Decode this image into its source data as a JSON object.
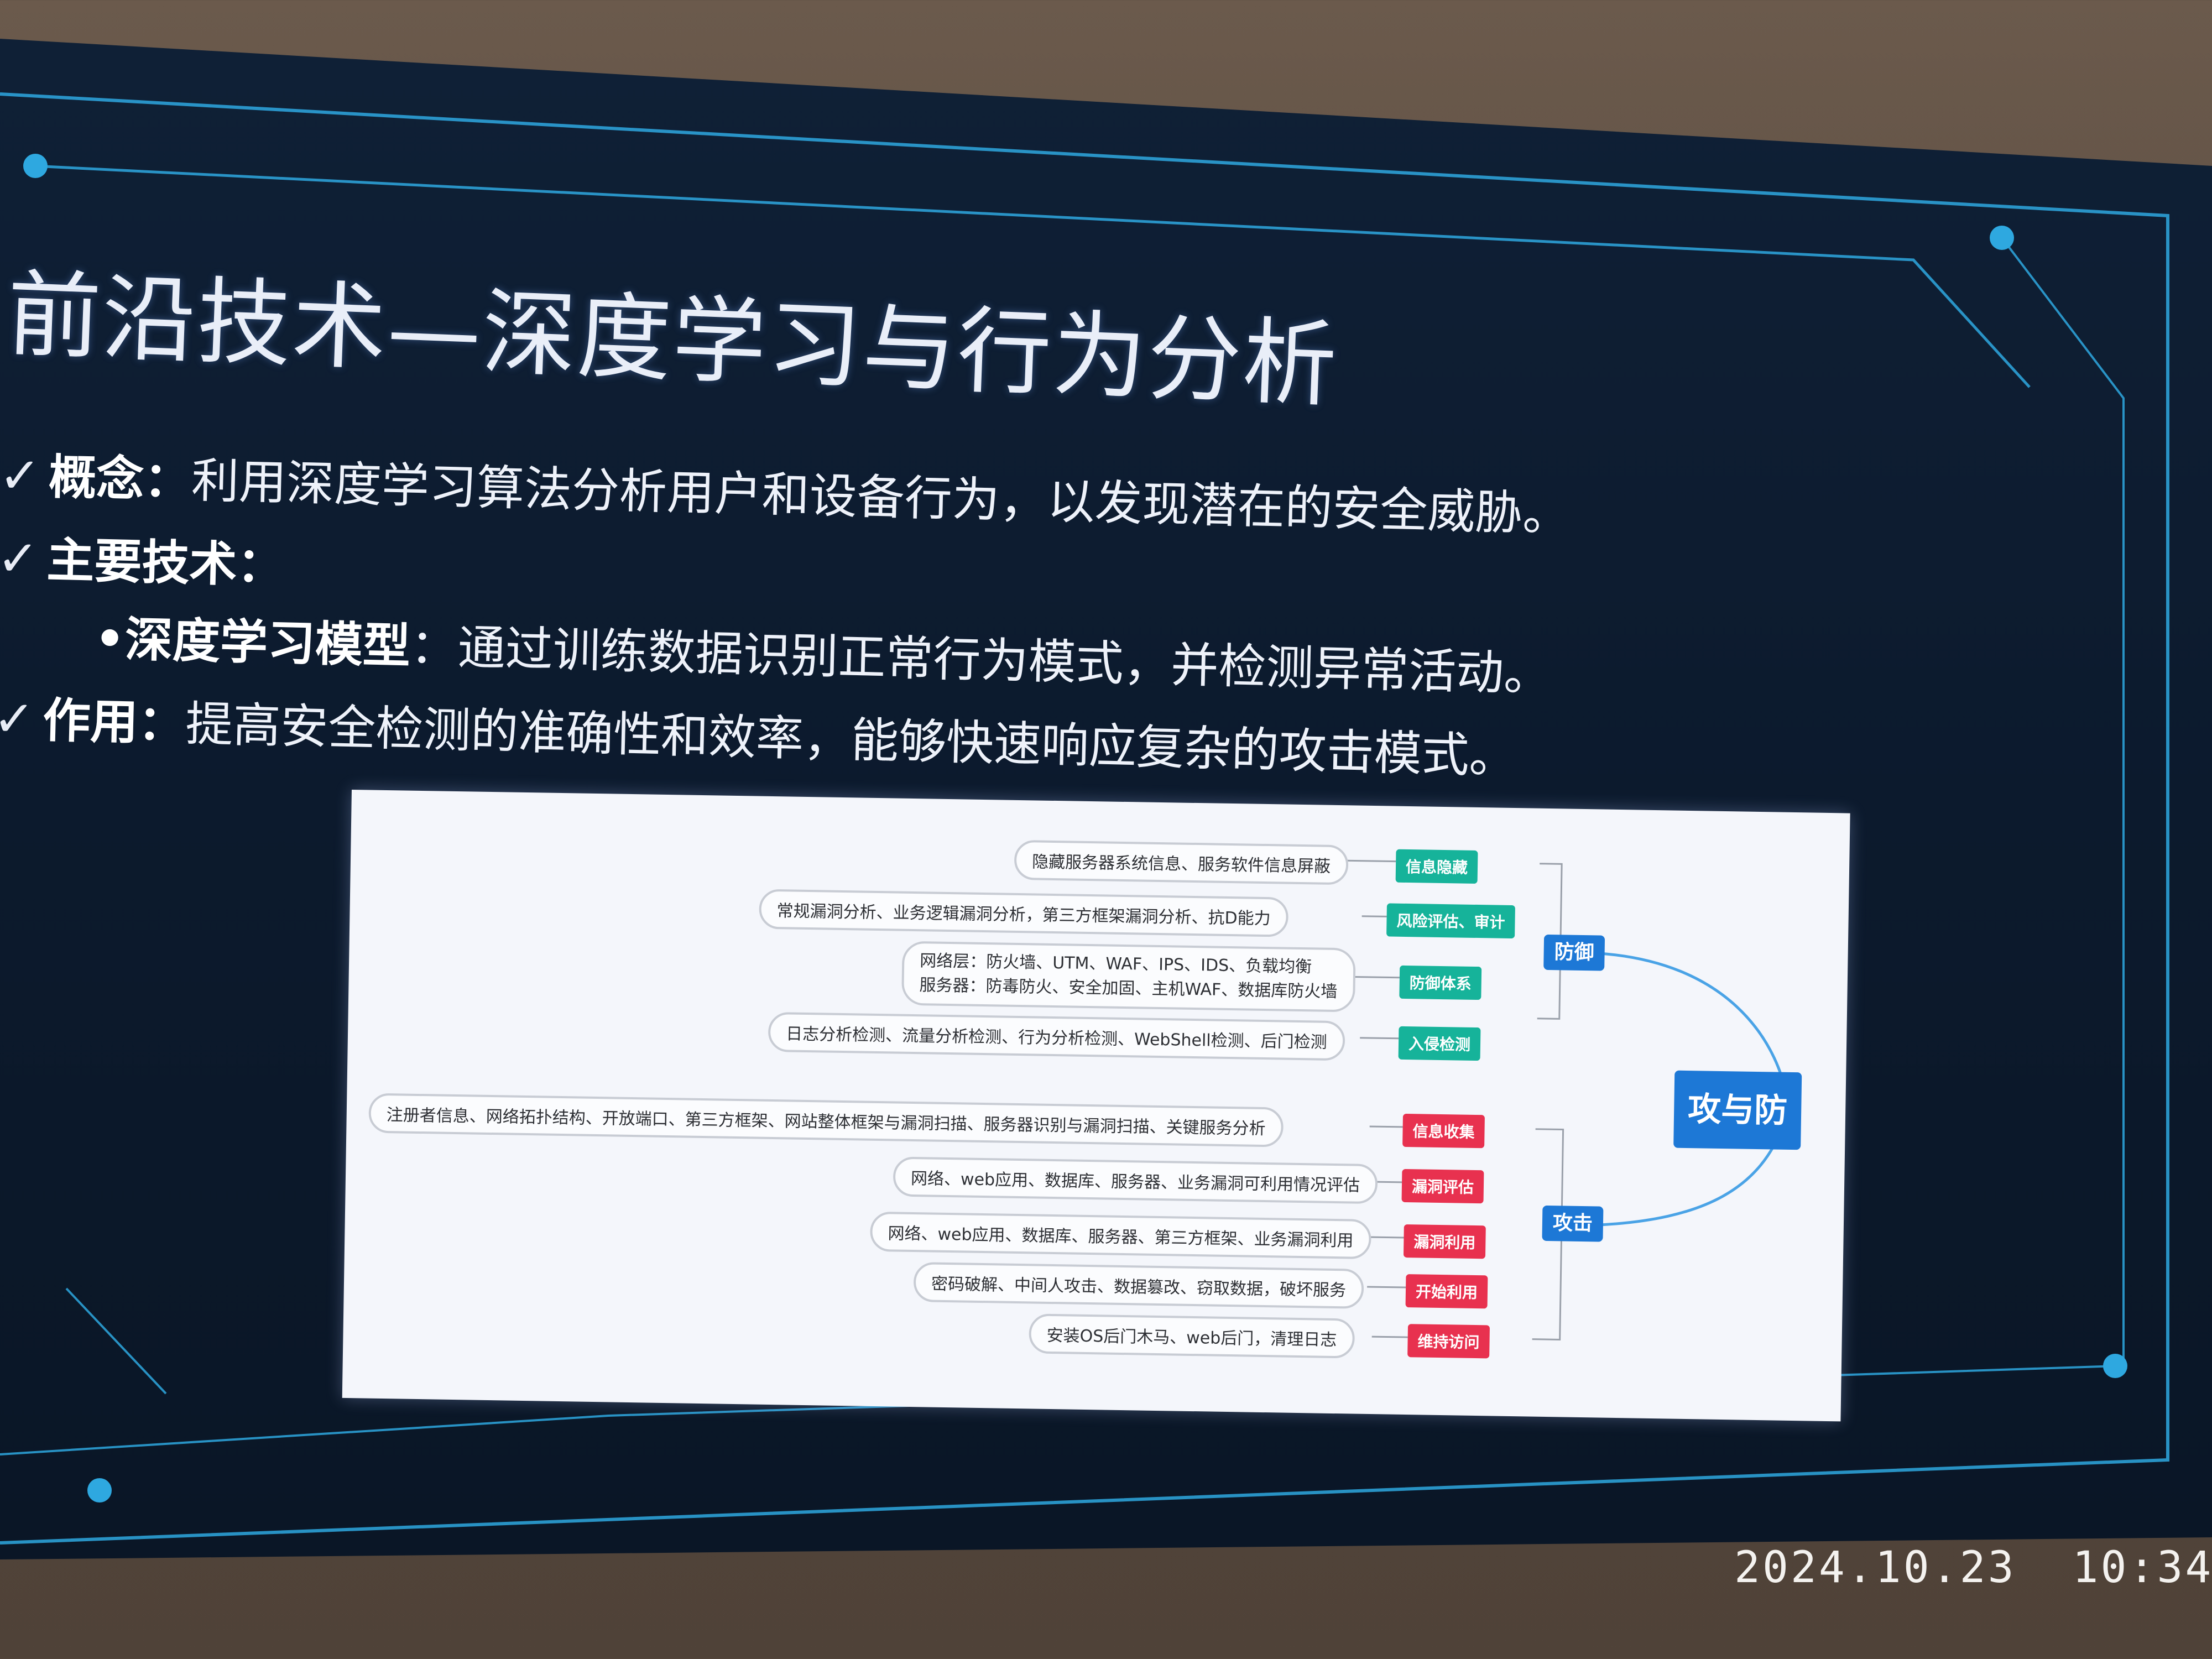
{
  "slide": {
    "title": "前沿技术—深度学习与行为分析",
    "bullets": [
      {
        "check": "✓",
        "key": "概念：",
        "text": "利用深度学习算法分析用户和设备行为，以发现潜在的安全威胁。"
      },
      {
        "check": "✓",
        "key": "主要技术：",
        "text": ""
      },
      {
        "check": "✓",
        "key": "作用：",
        "text": "提高安全检测的准确性和效率，能够快速响应复杂的攻击模式。"
      }
    ],
    "sub_bullet": {
      "key": "•深度学习模型",
      "text": "：通过训练数据识别正常行为模式，并检测异常活动。"
    }
  },
  "mindmap": {
    "root": "攻与防",
    "defense": {
      "label": "防御",
      "items": [
        {
          "tag": "信息隐藏",
          "detail": "隐藏服务器系统信息、服务软件信息屏蔽"
        },
        {
          "tag": "风险评估、审计",
          "detail": "常规漏洞分析、业务逻辑漏洞分析，第三方框架漏洞分析、抗D能力"
        },
        {
          "tag": "防御体系",
          "detail": "网络层：防火墙、UTM、WAF、IPS、IDS、负载均衡",
          "detail2": "服务器：防毒防火、安全加固、主机WAF、数据库防火墙"
        },
        {
          "tag": "入侵检测",
          "detail": "日志分析检测、流量分析检测、行为分析检测、WebShell检测、后门检测"
        }
      ]
    },
    "attack": {
      "label": "攻击",
      "items": [
        {
          "tag": "信息收集",
          "detail": "注册者信息、网络拓扑结构、开放端口、第三方框架、网站整体框架与漏洞扫描、服务器识别与漏洞扫描、关键服务分析"
        },
        {
          "tag": "漏洞评估",
          "detail": "网络、web应用、数据库、服务器、业务漏洞可利用情况评估"
        },
        {
          "tag": "漏洞利用",
          "detail": "网络、web应用、数据库、服务器、第三方框架、业务漏洞利用"
        },
        {
          "tag": "开始利用",
          "detail": "密码破解、中间人攻击、数据篡改、窃取数据，破坏服务"
        },
        {
          "tag": "维持访问",
          "detail": "安装OS后门木马、web后门，清理日志"
        }
      ]
    }
  },
  "photo": {
    "timestamp": "2024.10.23  10:34"
  },
  "colors": {
    "screen_bg": "#0d1a2e",
    "frame_cyan": "#2ea8e0",
    "defense_tag": "#16b39a",
    "attack_tag": "#e8314f",
    "hub_blue": "#1d78d6"
  }
}
